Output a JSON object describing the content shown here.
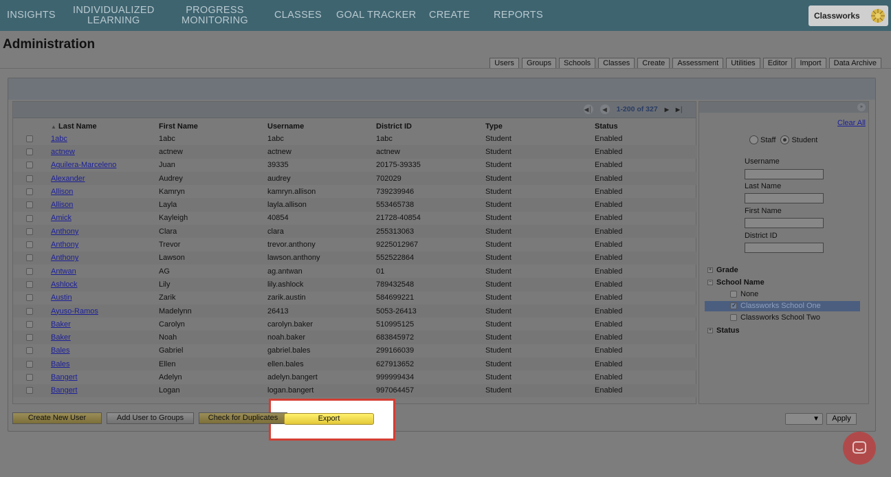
{
  "nav": {
    "items": [
      {
        "line1": "INSIGHTS",
        "line2": ""
      },
      {
        "line1": "INDIVIDUALIZED",
        "line2": "LEARNING"
      },
      {
        "line1": "PROGRESS",
        "line2": "MONITORING"
      },
      {
        "line1": "CLASSES",
        "line2": ""
      },
      {
        "line1": "GOAL TRACKER",
        "line2": ""
      },
      {
        "line1": "CREATE",
        "line2": ""
      },
      {
        "line1": "REPORTS",
        "line2": ""
      }
    ],
    "brand": "Classworks"
  },
  "page_title": "Administration",
  "tabs": [
    "Users",
    "Groups",
    "Schools",
    "Classes",
    "Create",
    "Assessment",
    "Utilities",
    "Editor",
    "Import",
    "Data Archive"
  ],
  "pager": {
    "text": "1-200 of 327"
  },
  "table": {
    "sort_indicator": "▲",
    "headers": [
      "Last Name",
      "First Name",
      "Username",
      "District ID",
      "Type",
      "Status"
    ],
    "rows": [
      [
        "1abc",
        "1abc",
        "1abc",
        "1abc",
        "Student",
        "Enabled"
      ],
      [
        "actnew",
        "actnew",
        "actnew",
        "actnew",
        "Student",
        "Enabled"
      ],
      [
        "Aguilera-Marceleno",
        "Juan",
        "39335",
        "20175-39335",
        "Student",
        "Enabled"
      ],
      [
        "Alexander",
        "Audrey",
        "audrey",
        "702029",
        "Student",
        "Enabled"
      ],
      [
        "Allison",
        "Kamryn",
        "kamryn.allison",
        "739239946",
        "Student",
        "Enabled"
      ],
      [
        "Allison",
        "Layla",
        "layla.allison",
        "553465738",
        "Student",
        "Enabled"
      ],
      [
        "Amick",
        "Kayleigh",
        "40854",
        "21728-40854",
        "Student",
        "Enabled"
      ],
      [
        "Anthony",
        "Clara",
        "clara",
        "255313063",
        "Student",
        "Enabled"
      ],
      [
        "Anthony",
        "Trevor",
        "trevor.anthony",
        "9225012967",
        "Student",
        "Enabled"
      ],
      [
        "Anthony",
        "Lawson",
        "lawson.anthony",
        "552522864",
        "Student",
        "Enabled"
      ],
      [
        "Antwan",
        "AG",
        "ag.antwan",
        "01",
        "Student",
        "Enabled"
      ],
      [
        "Ashlock",
        "Lily",
        "lily.ashlock",
        "789432548",
        "Student",
        "Enabled"
      ],
      [
        "Austin",
        "Zarik",
        "zarik.austin",
        "584699221",
        "Student",
        "Enabled"
      ],
      [
        "Ayuso-Ramos",
        "Madelynn",
        "26413",
        "5053-26413",
        "Student",
        "Enabled"
      ],
      [
        "Baker",
        "Carolyn",
        "carolyn.baker",
        "510995125",
        "Student",
        "Enabled"
      ],
      [
        "Baker",
        "Noah",
        "noah.baker",
        "683845972",
        "Student",
        "Enabled"
      ],
      [
        "Bales",
        "Gabriel",
        "gabriel.bales",
        "299166039",
        "Student",
        "Enabled"
      ],
      [
        "Bales",
        "Ellen",
        "ellen.bales",
        "627913652",
        "Student",
        "Enabled"
      ],
      [
        "Bangert",
        "Adelyn",
        "adelyn.bangert",
        "999999434",
        "Student",
        "Enabled"
      ],
      [
        "Bangert",
        "Logan",
        "logan.bangert",
        "997064457",
        "Student",
        "Enabled"
      ]
    ]
  },
  "buttons": {
    "create_user": "Create New User",
    "add_to_groups": "Add User to Groups",
    "check_duplicates": "Check for Duplicates",
    "export": "Export",
    "apply": "Apply"
  },
  "side": {
    "clear_all": "Clear All",
    "staff_label": "Staff",
    "student_label": "Student",
    "fields": [
      "Username",
      "Last Name",
      "First Name",
      "District ID"
    ],
    "tree": {
      "grade": "Grade",
      "school_name": "School Name",
      "none": "None",
      "school_one": "Classworks School One",
      "school_two": "Classworks School Two",
      "status": "Status"
    }
  }
}
